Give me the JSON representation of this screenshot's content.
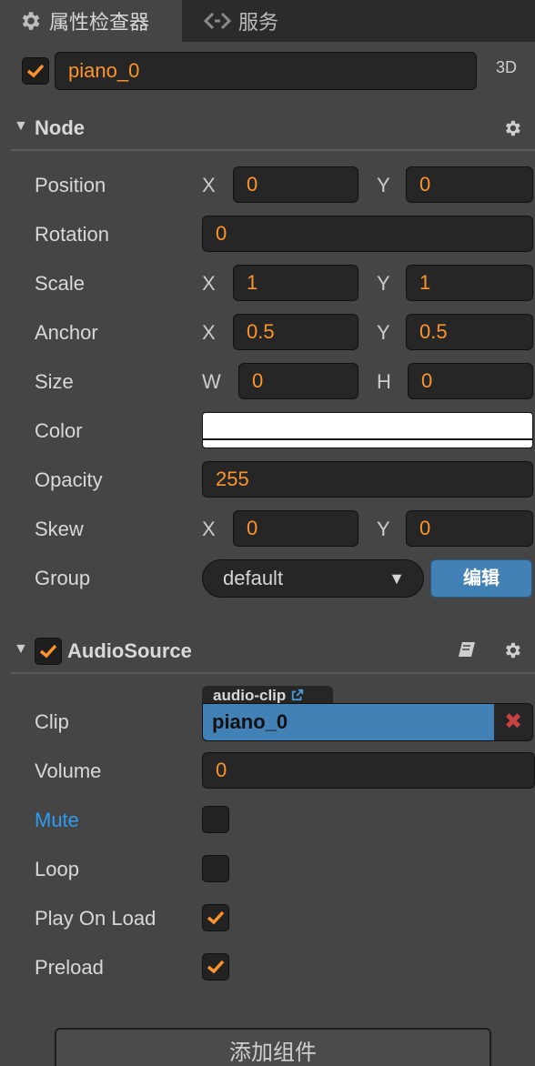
{
  "tabs": [
    {
      "label": "属性检查器",
      "icon": "gear-icon",
      "active": true
    },
    {
      "label": "服务",
      "icon": "service-icon",
      "active": false
    }
  ],
  "node": {
    "enabled": true,
    "name": "piano_0",
    "mode_label": "3D"
  },
  "node_section": {
    "title": "Node",
    "position": {
      "label": "Position",
      "x_label": "X",
      "x": "0",
      "y_label": "Y",
      "y": "0"
    },
    "rotation": {
      "label": "Rotation",
      "value": "0"
    },
    "scale": {
      "label": "Scale",
      "x_label": "X",
      "x": "1",
      "y_label": "Y",
      "y": "1"
    },
    "anchor": {
      "label": "Anchor",
      "x_label": "X",
      "x": "0.5",
      "y_label": "Y",
      "y": "0.5"
    },
    "size": {
      "label": "Size",
      "w_label": "W",
      "w": "0",
      "h_label": "H",
      "h": "0"
    },
    "color": {
      "label": "Color",
      "value": "#ffffff"
    },
    "opacity": {
      "label": "Opacity",
      "value": "255"
    },
    "skew": {
      "label": "Skew",
      "x_label": "X",
      "x": "0",
      "y_label": "Y",
      "y": "0"
    },
    "group": {
      "label": "Group",
      "value": "default",
      "edit_label": "编辑"
    }
  },
  "audio_section": {
    "title": "AudioSource",
    "enabled": true,
    "clip": {
      "label": "Clip",
      "type_tag": "audio-clip",
      "value": "piano_0"
    },
    "volume": {
      "label": "Volume",
      "value": "0"
    },
    "mute": {
      "label": "Mute",
      "checked": false
    },
    "loop": {
      "label": "Loop",
      "checked": false
    },
    "play_on_load": {
      "label": "Play On Load",
      "checked": true
    },
    "preload": {
      "label": "Preload",
      "checked": true
    }
  },
  "add_component_label": "添加组件",
  "colors": {
    "accent_orange": "#fd942b",
    "accent_blue": "#4281b6",
    "link_blue": "#2f9cf0",
    "clear_red": "#c74240",
    "panel_bg": "#454545"
  }
}
